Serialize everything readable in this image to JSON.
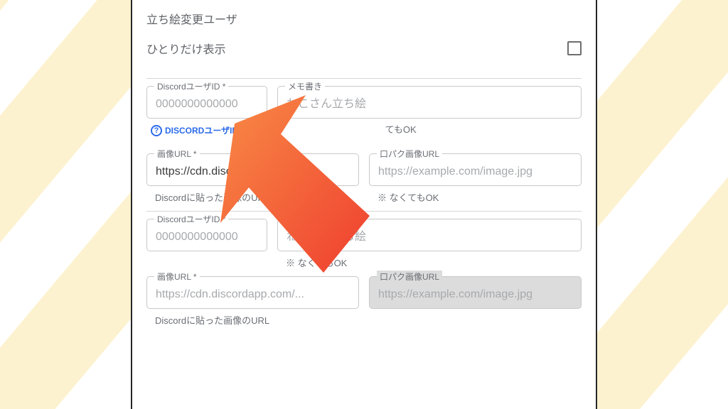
{
  "section_title": "立ち絵変更ユーザ",
  "toggle": {
    "label": "ひとりだけ表示"
  },
  "help": {
    "label": "DISCORDユーザIDと"
  },
  "labels": {
    "discord_id": "DiscordユーザID *",
    "memo": "メモ書き",
    "image_url": "画像URL *",
    "lipsync_url": "口パク画像URL"
  },
  "placeholders": {
    "discord_id": "0000000000000",
    "memo": "ねこさん立ち絵",
    "image_url": "https://cdn.discordapp.com/...",
    "lipsync_url": "https://example.com/image.jpg"
  },
  "hints": {
    "memo_ok": "てもOK",
    "memo_ok_full": "※ なくてもOK",
    "image_url": "Discordに貼った画像のURL",
    "image_url_cut": "Discordに貼った画像のURL",
    "lipsync_ok": "※ なくてもOK"
  },
  "users": [
    {
      "image_url_value": "https://cdn.discordu"
    },
    {
      "image_url_value": ""
    }
  ]
}
